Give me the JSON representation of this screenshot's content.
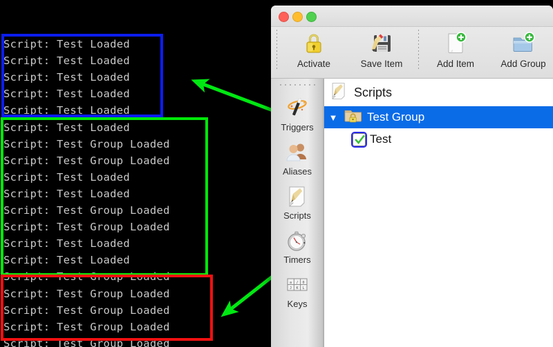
{
  "terminal": {
    "background": "#000000",
    "text_color": "#c8c8c8",
    "lines": [
      {
        "text": "Script: Test Loaded",
        "group": "blue"
      },
      {
        "text": "Script: Test Loaded",
        "group": "blue"
      },
      {
        "text": "Script: Test Loaded",
        "group": "blue"
      },
      {
        "text": "Script: Test Loaded",
        "group": "blue"
      },
      {
        "text": "Script: Test Loaded",
        "group": "blue"
      },
      {
        "text": "Script: Test Loaded",
        "group": "green"
      },
      {
        "text": "Script: Test Group Loaded",
        "group": "green"
      },
      {
        "text": "Script: Test Group Loaded",
        "group": "green"
      },
      {
        "text": "Script: Test Loaded",
        "group": "green"
      },
      {
        "text": "Script: Test Loaded",
        "group": "green"
      },
      {
        "text": "Script: Test Group Loaded",
        "group": "green"
      },
      {
        "text": "Script: Test Group Loaded",
        "group": "green"
      },
      {
        "text": "Script: Test Loaded",
        "group": "green"
      },
      {
        "text": "Script: Test Loaded",
        "group": "green"
      },
      {
        "text": "Script: Test Group Loaded",
        "group": "green"
      },
      {
        "text": "Script: Test Group Loaded",
        "group": "red"
      },
      {
        "text": "Script: Test Group Loaded",
        "group": "red"
      },
      {
        "text": "Script: Test Group Loaded",
        "group": "red"
      },
      {
        "text": "Script: Test Group Loaded",
        "group": "red"
      }
    ]
  },
  "annotations": {
    "boxes": [
      {
        "name": "blue-highlight-box",
        "color": "#0b1df0"
      },
      {
        "name": "green-highlight-box",
        "color": "#00e808"
      },
      {
        "name": "red-highlight-box",
        "color": "#f21010"
      }
    ],
    "arrow_color": "#00e812",
    "arrows": [
      {
        "name": "arrow-test-item-to-blue-box",
        "from": "Test checkbox row",
        "to": "blue highlight box"
      },
      {
        "name": "arrow-test-group-to-red-box",
        "from": "Test Group row",
        "to": "red highlight box"
      }
    ]
  },
  "window": {
    "traffic_lights": {
      "close": "close-button",
      "minimize": "minimize-button",
      "maximize": "maximize-button"
    },
    "toolbar": {
      "items": [
        {
          "label": "Activate",
          "icon": "lock-icon"
        },
        {
          "label": "Save Item",
          "icon": "save-floppy-pencil-icon"
        },
        {
          "label": "Add Item",
          "icon": "document-plus-icon"
        },
        {
          "label": "Add Group",
          "icon": "folder-plus-icon"
        }
      ]
    },
    "sidebar": {
      "items": [
        {
          "label": "Triggers",
          "icon": "magic-wand-icon"
        },
        {
          "label": "Aliases",
          "icon": "people-icon"
        },
        {
          "label": "Scripts",
          "icon": "document-pencil-icon"
        },
        {
          "label": "Timers",
          "icon": "stopwatch-icon"
        },
        {
          "label": "Keys",
          "icon": "keyboard-icon"
        }
      ]
    },
    "list": {
      "header": {
        "title": "Scripts",
        "icon": "document-pencil-icon"
      },
      "rows": [
        {
          "label": "Test Group",
          "icon": "folder-lock-icon",
          "selected": true,
          "disclosure": "▼",
          "level": 0
        },
        {
          "label": "Test",
          "icon": "checkbox-checked-icon",
          "selected": false,
          "disclosure": "",
          "level": 1
        }
      ]
    },
    "colors": {
      "selection_blue": "#0b6ce8",
      "checkbox_focus_ring": "#2b2bf0",
      "checkmark_green": "#3bbf3b"
    }
  }
}
